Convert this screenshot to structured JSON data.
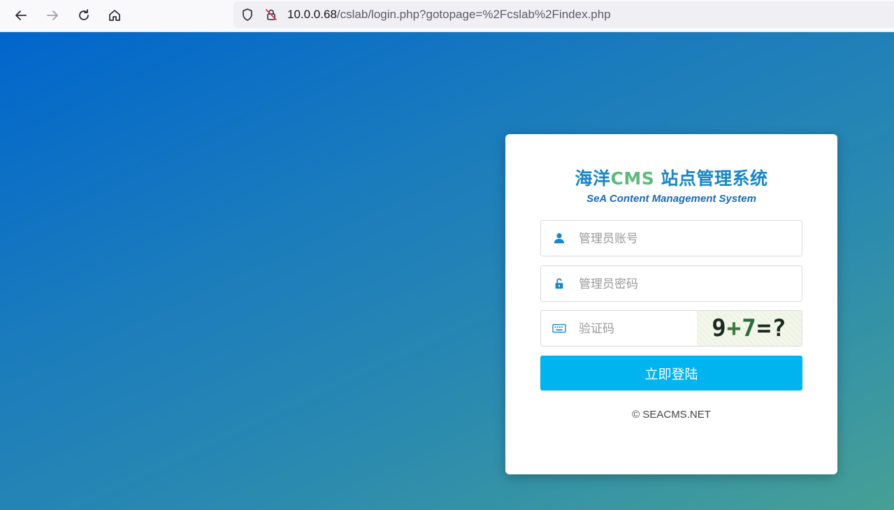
{
  "browser": {
    "url_host": "10.0.0.68",
    "url_path": "/cslab/login.php?gotopage=%2Fcslab%2Findex.php",
    "icons": [
      "back-arrow-icon",
      "forward-arrow-icon",
      "reload-icon",
      "home-icon",
      "shield-icon",
      "insecure-lock-icon"
    ]
  },
  "login": {
    "title_part1": "海洋",
    "title_cms": "CMS",
    "title_part2": " 站点管理系统",
    "subtitle": "SeA Content Management System",
    "username_placeholder": "管理员账号",
    "password_placeholder": "管理员密码",
    "captcha_placeholder": "验证码",
    "captcha_text": {
      "a": "9",
      "op": "+",
      "b": "7",
      "eq": "=",
      "q": "?"
    },
    "submit_label": "立即登陆",
    "footer": "© SEACMS.NET"
  },
  "colors": {
    "accent": "#00b4ef",
    "title_blue": "#1a86c6",
    "title_green": "#5dbb7a"
  }
}
